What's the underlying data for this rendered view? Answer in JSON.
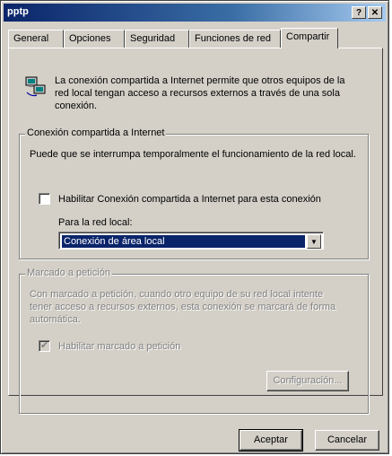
{
  "window": {
    "title": "pptp",
    "help_glyph": "?",
    "close_glyph": "✕"
  },
  "tabs": [
    {
      "label": "General"
    },
    {
      "label": "Opciones"
    },
    {
      "label": "Seguridad"
    },
    {
      "label": "Funciones de red"
    },
    {
      "label": "Compartir"
    }
  ],
  "intro_text": "La conexión compartida a Internet permite que otros equipos de la red local tengan acceso a recursos externos a través de una sola conexión.",
  "ics_group": {
    "legend": "Conexión compartida a Internet",
    "description": "Puede que se interrumpa temporalmente el funcionamiento de la red local.",
    "enable_label": "Habilitar Conexión compartida a Internet para esta conexión",
    "enable_checked": false,
    "lan_label": "Para la red local:",
    "lan_selected": "Conexión de área local"
  },
  "dod_group": {
    "legend": "Marcado a petición",
    "description": "Con marcado a petición, cuando otro equipo de su red local intente tener acceso a recursos externos, esta conexión se marcará de forma automática.",
    "enable_label": "Habilitar marcado a petición",
    "enable_checked": true,
    "settings_button": "Configuración..."
  },
  "footer": {
    "ok": "Aceptar",
    "cancel": "Cancelar"
  }
}
